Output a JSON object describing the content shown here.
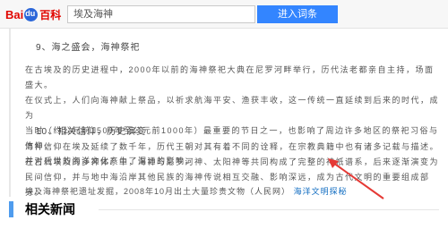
{
  "header": {
    "logo_part1": "Bai",
    "logo_part2": "百科",
    "search_value": "埃及海神",
    "search_button_label": "进入词条"
  },
  "article": {
    "section9_title": "9、海之盛会，海神祭祀",
    "para9_lines": [
      "在古埃及的历史进程中，2000年以前的海神祭祀大典在尼罗河畔举行，历代法老都亲自主持，场面盛大。",
      "在仪式上，人们向海神献上祭品，以祈求航海平安、渔获丰收，这一传统一直延续到后来的时代，成为",
      "当时（约公元前1500年至公元前1000年）最重要的节日之一，也影响了周边许多地区的祭祀习俗与信仰，",
      "并对后世的海洋文化产生了深远的影响。"
    ],
    "section10_title": "10、相关信仰，历史演变",
    "para10_lines": [
      "海神信仰在埃及延续了数千年，历代王朝对其有着不同的诠释，在宗教典籍中也有诸多记载与描述。",
      "在古代埃及的多神体系中，海神与尼罗河神、太阳神等共同构成了完整的神祇谱系，后来逐渐演变为",
      "民间信仰，并与地中海沿岸其他民族的海神传说相互交融、影响深远，成为古代文明的重要组成部分。"
    ],
    "links": {
      "l1": "海神信仰",
      "l2": "尼罗河神",
      "l3": "地中海"
    }
  },
  "related": {
    "title": "相关新闻",
    "item1": "埃及海神祭祀遗址发掘，2008年10月出土大量珍贵文物（人民网）",
    "item1_tail": "海洋文明探秘"
  }
}
